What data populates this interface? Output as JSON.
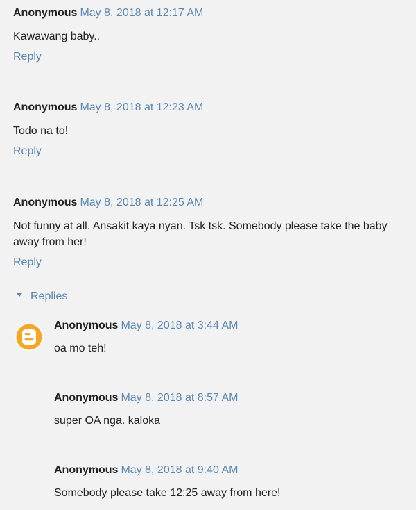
{
  "comments": [
    {
      "author": "Anonymous",
      "date": "May 8, 2018 at 12:17 AM",
      "text": "Kawawang baby..",
      "reply": "Reply"
    },
    {
      "author": "Anonymous",
      "date": "May 8, 2018 at 12:23 AM",
      "text": "Todo na to!",
      "reply": "Reply"
    },
    {
      "author": "Anonymous",
      "date": "May 8, 2018 at 12:25 AM",
      "text": "Not funny at all. Ansakit kaya nyan. Tsk tsk. Somebody please take the baby away from her!",
      "reply": "Reply"
    }
  ],
  "replies_toggle": "Replies",
  "replies": [
    {
      "author": "Anonymous",
      "date": "May 8, 2018 at 3:44 AM",
      "text": "oa mo teh!"
    },
    {
      "author": "Anonymous",
      "date": "May 8, 2018 at 8:57 AM",
      "text": "super OA nga. kaloka"
    },
    {
      "author": "Anonymous",
      "date": "May 8, 2018 at 9:40 AM",
      "text": "Somebody please take 12:25 away from here!"
    }
  ],
  "colors": {
    "link": "#5b87b3",
    "avatar": "#f5a623",
    "background": "#f2f2f2"
  },
  "icons": {
    "avatar": "blogger-icon",
    "replies_toggle": "caret-down-icon"
  }
}
